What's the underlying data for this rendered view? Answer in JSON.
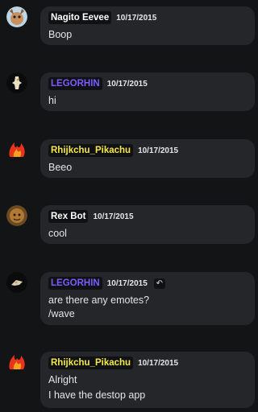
{
  "messages": [
    {
      "name": "Nagito Eevee",
      "name_color": "#ffffff",
      "time": "10/17/2015",
      "lines": [
        "Boop"
      ],
      "avatar": "eevee-avatar"
    },
    {
      "name": "LEGORHIN",
      "name_color": "#7b5cff",
      "time": "10/17/2015",
      "lines": [
        "hi"
      ],
      "avatar": "lego-avatar"
    },
    {
      "name": "Rhijkchu_Pikachu",
      "name_color": "#f5e94a",
      "time": "10/17/2015",
      "lines": [
        "Beeo"
      ],
      "avatar": "flame-avatar"
    },
    {
      "name": "Rex Bot",
      "name_color": "#ffffff",
      "time": "10/17/2015",
      "lines": [
        "cool"
      ],
      "avatar": "rex-avatar"
    },
    {
      "name": "LEGORHIN",
      "name_color": "#7b5cff",
      "time": "10/17/2015",
      "lines": [
        "are there any emotes?",
        "/wave"
      ],
      "avatar": "lego-avatar",
      "reply_icon": "reply-arrow-icon"
    },
    {
      "name": "Rhijkchu_Pikachu",
      "name_color": "#f5e94a",
      "time": "10/17/2015",
      "lines": [
        "Alright",
        "I have the destop app"
      ],
      "avatar": "flame-avatar"
    }
  ]
}
